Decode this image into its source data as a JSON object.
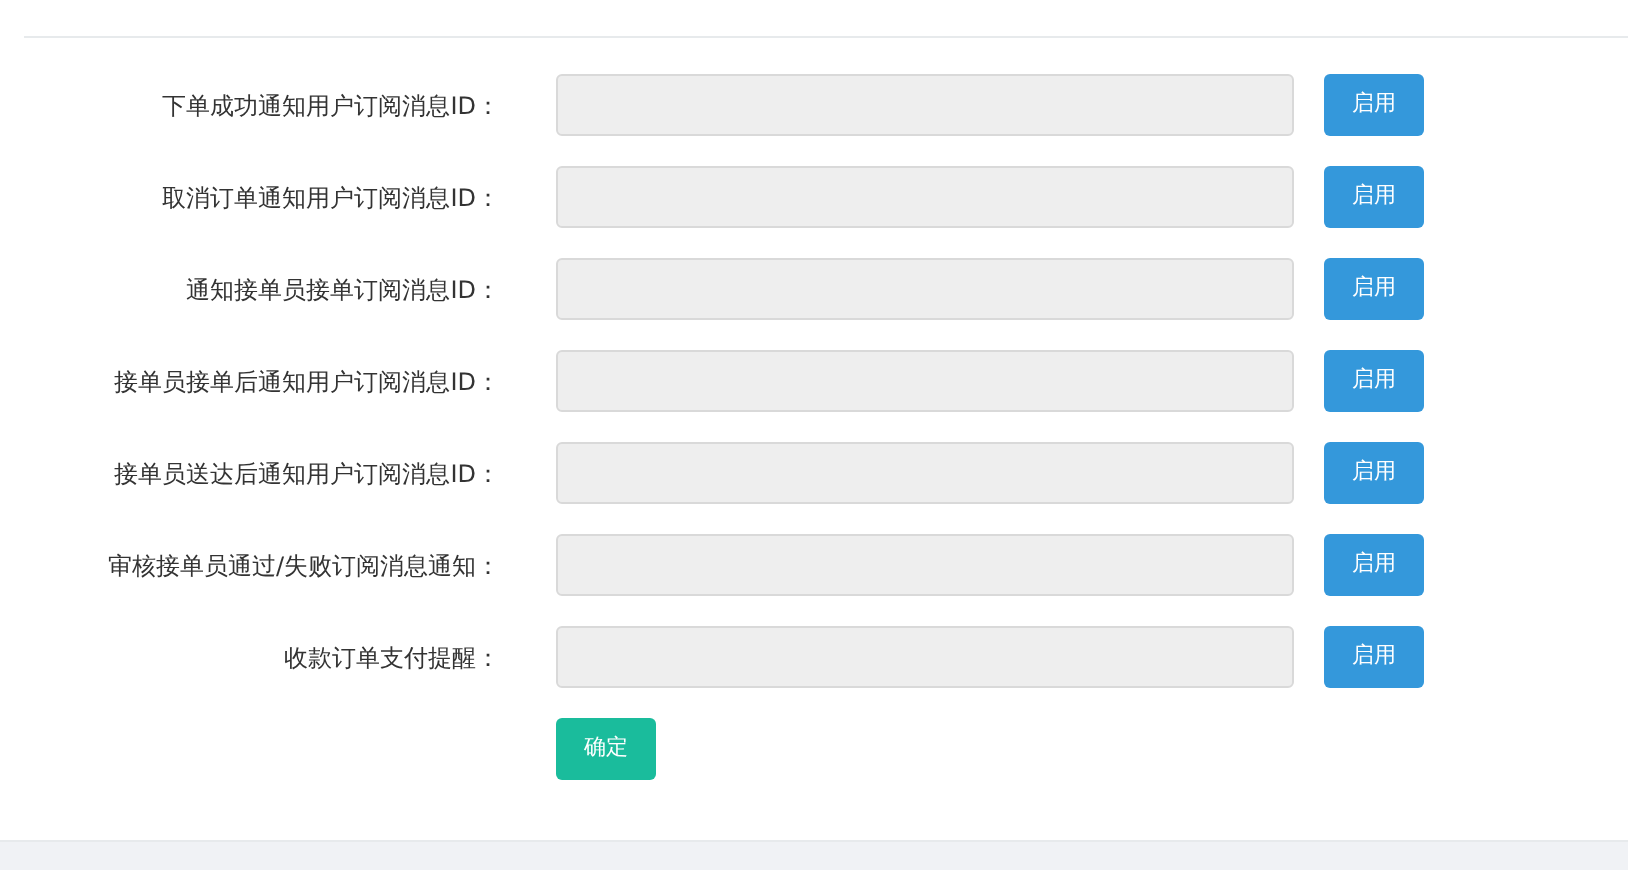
{
  "form": {
    "rows": [
      {
        "label": "下单成功通知用户订阅消息ID：",
        "button": "启用"
      },
      {
        "label": "取消订单通知用户订阅消息ID：",
        "button": "启用"
      },
      {
        "label": "通知接单员接单订阅消息ID：",
        "button": "启用"
      },
      {
        "label": "接单员接单后通知用户订阅消息ID：",
        "button": "启用"
      },
      {
        "label": "接单员送达后通知用户订阅消息ID：",
        "button": "启用"
      },
      {
        "label": "审核接单员通过/失败订阅消息通知：",
        "button": "启用"
      },
      {
        "label": "收款订单支付提醒：",
        "button": "启用"
      }
    ],
    "submit": "确定"
  }
}
